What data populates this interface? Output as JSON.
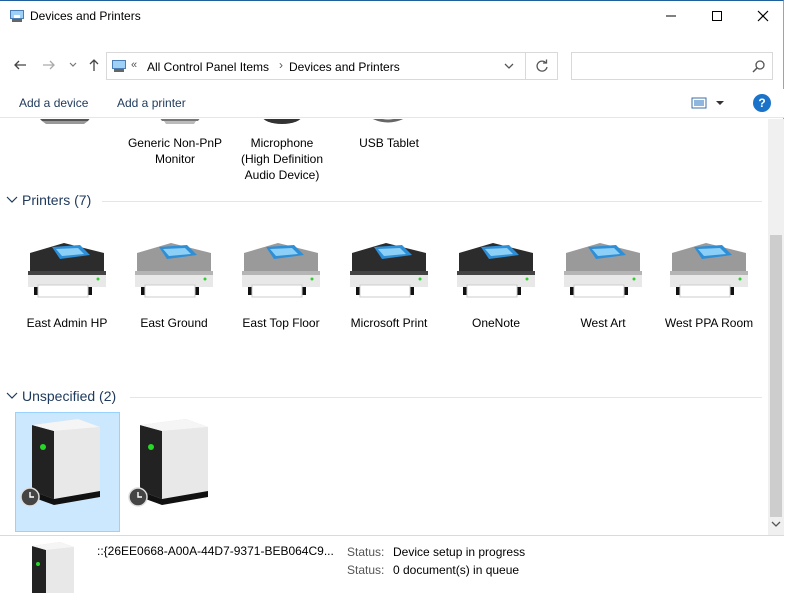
{
  "window": {
    "title": "Devices and Printers"
  },
  "address": {
    "overflow": "«",
    "crumbs": [
      "All Control Panel Items",
      "Devices and Printers"
    ],
    "separator": "›",
    "search_placeholder": ""
  },
  "commands": {
    "add_device": "Add a device",
    "add_printer": "Add a printer",
    "help": "?"
  },
  "devices_partial": [
    {
      "label": "Generic Non-PnP Monitor",
      "line1": "Generic Non-PnP",
      "line2": "Monitor",
      "line3": ""
    },
    {
      "label": "Microphone (High Definition Audio Device)",
      "line1": "Microphone",
      "line2": "(High Definition",
      "line3": "Audio Device)"
    },
    {
      "label": "USB Tablet",
      "line1": "USB Tablet",
      "line2": "",
      "line3": ""
    }
  ],
  "printers": {
    "header": "Printers (7)",
    "items": [
      {
        "label": "East Admin HP",
        "dark": true
      },
      {
        "label": "East Ground",
        "dark": false
      },
      {
        "label": "East Top Floor",
        "dark": false
      },
      {
        "label": "Microsoft Print",
        "dark": true
      },
      {
        "label": "OneNote",
        "dark": true
      },
      {
        "label": "West Art",
        "dark": false
      },
      {
        "label": "West PPA Room",
        "dark": false
      }
    ]
  },
  "unspecified": {
    "header": "Unspecified (2)"
  },
  "details": {
    "device_name": "::{26EE0668-A00A-44D7-9371-BEB064C9...",
    "status_label_1": "Status:",
    "status_value_1": "Device setup in progress",
    "status_label_2": "Status:",
    "status_value_2": "0 document(s) in queue"
  },
  "colors": {
    "accent": "#1a73c8",
    "selection": "#cce8ff",
    "group_text": "#1e395b"
  }
}
